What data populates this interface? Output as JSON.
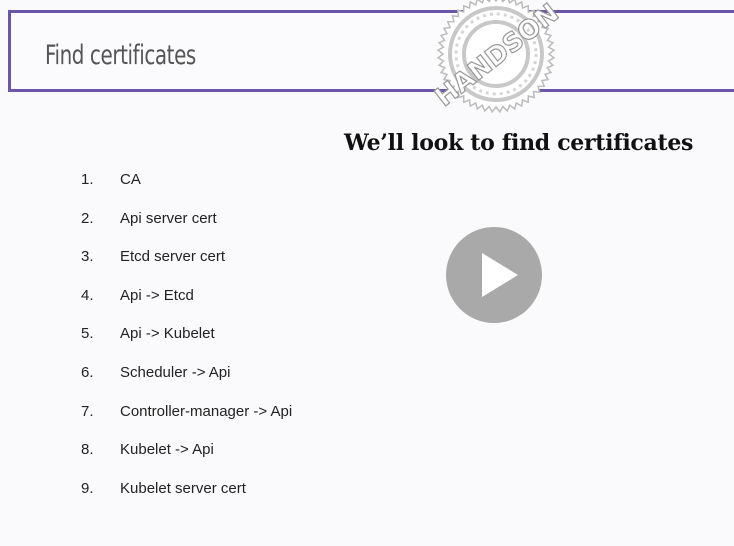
{
  "slide": {
    "title": "Find certificates",
    "heading": "We’ll look to find certificates",
    "stamp_text": "HANDSON",
    "items": [
      {
        "num": "1.",
        "text": "CA"
      },
      {
        "num": "2.",
        "text": "Api server cert"
      },
      {
        "num": "3.",
        "text": "Etcd server cert"
      },
      {
        "num": "4.",
        "text": "Api -> Etcd"
      },
      {
        "num": "5.",
        "text": "Api -> Kubelet"
      },
      {
        "num": "6.",
        "text": "Scheduler -> Api"
      },
      {
        "num": "7.",
        "text": "Controller-manager -> Api"
      },
      {
        "num": "8.",
        "text": "Kubelet -> Api"
      },
      {
        "num": "9.",
        "text": "Kubelet server cert"
      }
    ]
  },
  "colors": {
    "accent": "#6a55a8",
    "play_button": "#a9a9a9"
  },
  "icons": {
    "play": "play-icon",
    "stamp": "handson-stamp-icon"
  }
}
